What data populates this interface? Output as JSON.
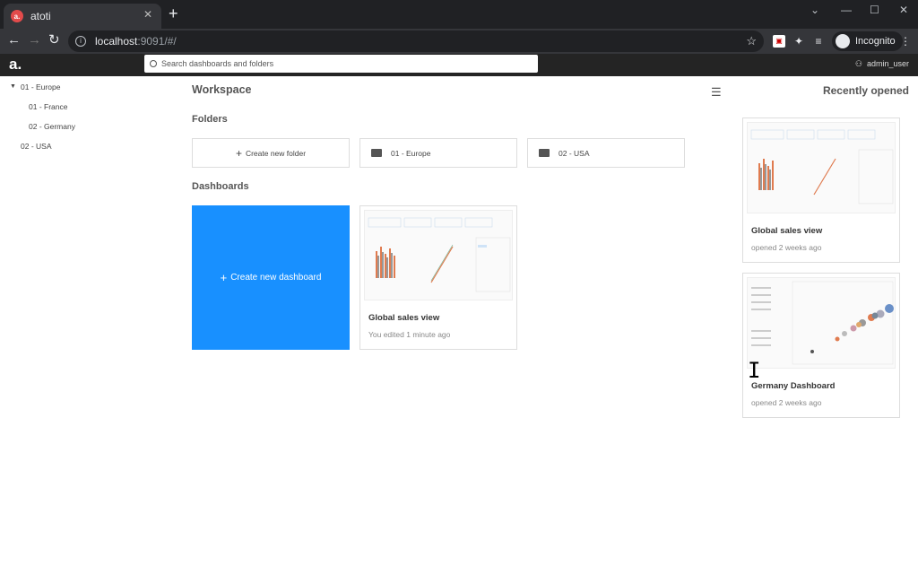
{
  "browser": {
    "tab_title": "atoti",
    "tab_favicon": "a.",
    "url_host": "localhost",
    "url_path": ":9091/#/",
    "incognito_label": "Incognito"
  },
  "app": {
    "logo": "a.",
    "search_placeholder": "Search dashboards and folders",
    "user": "admin_user"
  },
  "tree": [
    {
      "label": "01 - Europe",
      "level": 0,
      "expanded": true
    },
    {
      "label": "01 - France",
      "level": 1
    },
    {
      "label": "02 - Germany",
      "level": 1
    },
    {
      "label": "02 - USA",
      "level": 0
    }
  ],
  "workspace": {
    "title": "Workspace",
    "folders_heading": "Folders",
    "create_folder": "Create new folder",
    "folders": [
      "01 - Europe",
      "02 - USA"
    ],
    "dashboards_heading": "Dashboards",
    "create_dashboard": "Create new dashboard",
    "dashboards": [
      {
        "title": "Global sales view",
        "subtitle": "You edited 1 minute ago"
      }
    ]
  },
  "recent": {
    "title": "Recently opened",
    "items": [
      {
        "title": "Global sales view",
        "subtitle": "opened 2 weeks ago"
      },
      {
        "title": "Germany Dashboard",
        "subtitle": "opened 2 weeks ago"
      }
    ]
  },
  "colors": {
    "accent": "#1890ff",
    "appbar": "#242424",
    "chrome_dark": "#202124"
  }
}
